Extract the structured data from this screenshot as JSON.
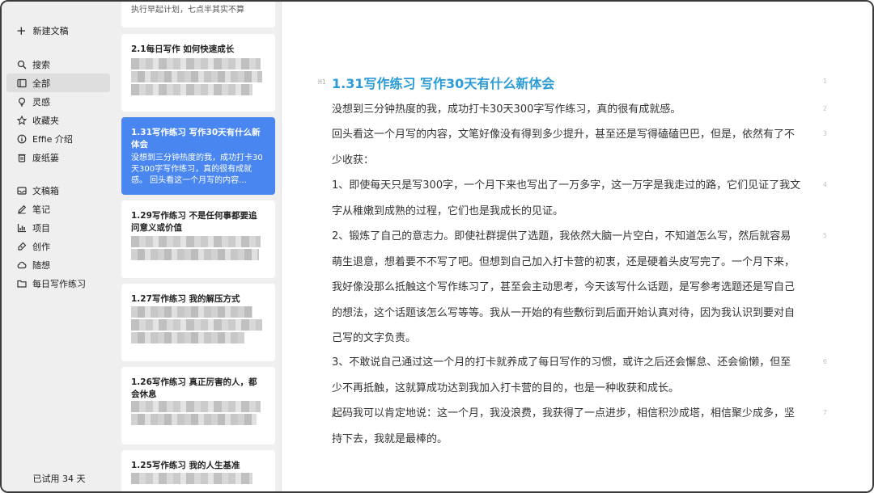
{
  "sidebar": {
    "new_doc": "新建文稿",
    "nav_primary": [
      {
        "label": "搜索",
        "icon": "search-icon"
      },
      {
        "label": "全部",
        "icon": "folder-icon",
        "active": true
      },
      {
        "label": "灵感",
        "icon": "lightbulb-icon"
      },
      {
        "label": "收藏夹",
        "icon": "star-icon"
      },
      {
        "label": "Effie 介绍",
        "icon": "info-icon"
      },
      {
        "label": "废纸篓",
        "icon": "trash-icon"
      }
    ],
    "nav_secondary": [
      {
        "label": "文稿箱",
        "icon": "inbox-icon"
      },
      {
        "label": "笔记",
        "icon": "pencil-icon"
      },
      {
        "label": "项目",
        "icon": "chart-icon"
      },
      {
        "label": "创作",
        "icon": "pen-icon"
      },
      {
        "label": "随想",
        "icon": "cloud-icon"
      },
      {
        "label": "每日写作练习",
        "icon": "folder-icon"
      }
    ],
    "trial": "已试用 34 天"
  },
  "doc_list": {
    "top_clip": "执行早起计划，七点半其实不算",
    "cards": [
      {
        "title": "2.1每日写作 如何快速成长",
        "preview": ""
      },
      {
        "title": "1.31写作练习 写作30天有什么新体会",
        "preview": "没想到三分钟热度的我，成功打卡30天300字写作练习，真的很有成就感。 回头看这一个月写的内容...",
        "active": true
      },
      {
        "title": "1.29写作练习 不是任何事都要追问意义或价值",
        "preview": ""
      },
      {
        "title": "1.27写作练习 我的解压方式",
        "preview": ""
      },
      {
        "title": "1.26写作练习 真正厉害的人，都会休息",
        "preview": ""
      },
      {
        "title": "1.25写作练习 我的人生基准",
        "preview": ""
      }
    ]
  },
  "editor": {
    "heading_tag": "H1",
    "title": "1.31写作练习 写作30天有什么新体会",
    "paragraphs": [
      {
        "num": "1",
        "text": "没想到三分钟热度的我，成功打卡30天300字写作练习，真的很有成就感。"
      },
      {
        "num": "2",
        "text": "回头看这一个月写的内容，文笔好像没有得到多少提升，甚至还是写得磕磕巴巴，但是，依然有了不少收获："
      },
      {
        "num": "3",
        "text": "1、即使每天只是写300字，一个月下来也写出了一万多字，这一万字是我走过的路，它们见证了我文字从稚嫩到成熟的过程，它们也是我成长的见证。"
      },
      {
        "num": "4",
        "text": "2、锻炼了自己的意志力。即使社群提供了选题，我依然大脑一片空白，不知道怎么写，然后就容易萌生退意，想着要不不写了吧。但想到自己加入打卡营的初衷，还是硬着头皮写完了。一个月下来，我好像没那么抵触这个写作练习了，甚至会主动思考，今天该写什么话题，是写参考选题还是写自己的想法，这个话题该怎么写等等。我从一开始的有些敷衍到后面开始认真对待，因为我认识到要对自己写的文字负责。"
      },
      {
        "num": "5",
        "text": "3、不敢说自己通过这一个月的打卡就养成了每日写作的习惯，或许之后还会懈怠、还会偷懒，但至少不再抵触，这就算成功达到我加入打卡营的目的，也是一种收获和成长。"
      },
      {
        "num": "6",
        "text": "起码我可以肯定地说：这一个月，我没浪费，我获得了一点进步，相信积沙成塔，相信聚少成多，坚持下去，我就是最棒的。"
      },
      {
        "num": "7",
        "text": ""
      }
    ]
  }
}
